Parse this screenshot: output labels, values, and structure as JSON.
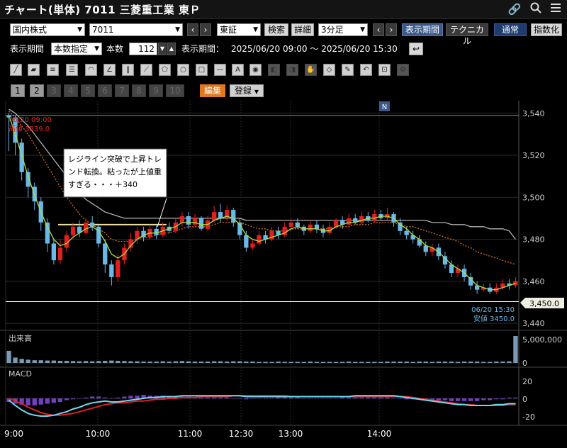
{
  "header": {
    "title": "チャート(単体) 7011 三菱重工業 東Ｐ"
  },
  "toolbar1": {
    "market": "国内株式",
    "code": "7011",
    "exchange": "東証",
    "search_label": "検索",
    "detail_label": "詳細",
    "interval": "3分足",
    "period_label": "表示期間",
    "technical_label": "テクニカル",
    "normal_label": "通常",
    "index_label": "指数化"
  },
  "toolbar2": {
    "display_period_label": "表示期間",
    "period_mode": "本数指定",
    "count_label": "本数",
    "count_value": "112",
    "range_label": "表示期間：",
    "range_value": "2025/06/20 09:00 〜 2025/06/20 15:30"
  },
  "toolbar3": {
    "tools": [
      "line",
      "ruler",
      "hlines",
      "hlines2",
      "arc",
      "fan",
      "vlines",
      "fan2",
      "pentagon",
      "circle",
      "rect",
      "hline",
      "text",
      "icon",
      "dim1",
      "dim2",
      "dim3",
      "eraser",
      "brush",
      "undo",
      "lock",
      "gear"
    ]
  },
  "toolbar4": {
    "pages": [
      "1",
      "2",
      "3",
      "4",
      "5",
      "6",
      "7",
      "8",
      "9",
      "10"
    ],
    "active_pages": 2,
    "edit_label": "編集",
    "register_label": "登録"
  },
  "colors": {
    "background": "#000000",
    "up": "#e02020",
    "down": "#6ab8e8",
    "ma_short": "#a8e040",
    "ma_long": "#b0b0b0",
    "ma_mid": "#d87020",
    "high_line": "#40c040",
    "current_line": "#ffffff",
    "macd": "#70d8f0",
    "signal": "#e02020",
    "hist": "#7040c0"
  },
  "price_chart": {
    "high_time": "06/20 09:00",
    "high_label": "高値 3539.0",
    "low_time": "06/20 15:30",
    "low_label": "安値 3450.0",
    "current_price": "3,450.0",
    "n_badge": "N",
    "annotation": [
      "レジライン突破で上昇トレ",
      "ンド転換。粘ったが上値重",
      "すぎる・・・＋340"
    ]
  },
  "volume_chart": {
    "title": "出来高",
    "max_label": "5,000,000",
    "zero_label": "0"
  },
  "macd_chart": {
    "title": "MACD",
    "labels": [
      "20",
      "0",
      "-20"
    ]
  },
  "chart_data": {
    "type": "candlestick",
    "yticks": [
      3440,
      3460,
      3480,
      3500,
      3520,
      3540
    ],
    "ylim": [
      3437,
      3546
    ],
    "xticks": [
      "9:00",
      "10:00",
      "11:00",
      "12:30",
      "13:00",
      "14:00"
    ],
    "high": 3539.0,
    "low": 3450.0,
    "current": 3450.0,
    "resistance": 3487,
    "candles": [
      [
        3539,
        3538,
        3540,
        3522
      ],
      [
        3538,
        3526,
        3539,
        3520
      ],
      [
        3526,
        3512,
        3528,
        3508
      ],
      [
        3512,
        3505,
        3514,
        3500
      ],
      [
        3505,
        3498,
        3507,
        3494
      ],
      [
        3498,
        3488,
        3500,
        3484
      ],
      [
        3488,
        3478,
        3490,
        3474
      ],
      [
        3478,
        3470,
        3480,
        3468
      ],
      [
        3470,
        3476,
        3480,
        3468
      ],
      [
        3476,
        3482,
        3484,
        3474
      ],
      [
        3482,
        3486,
        3488,
        3480
      ],
      [
        3486,
        3483,
        3489,
        3481
      ],
      [
        3483,
        3488,
        3490,
        3482
      ],
      [
        3488,
        3486,
        3491,
        3484
      ],
      [
        3486,
        3478,
        3487,
        3476
      ],
      [
        3478,
        3468,
        3480,
        3464
      ],
      [
        3468,
        3462,
        3470,
        3458
      ],
      [
        3462,
        3470,
        3473,
        3460
      ],
      [
        3470,
        3476,
        3478,
        3468
      ],
      [
        3476,
        3480,
        3483,
        3474
      ],
      [
        3480,
        3484,
        3486,
        3478
      ],
      [
        3484,
        3481,
        3486,
        3479
      ],
      [
        3481,
        3485,
        3487,
        3480
      ],
      [
        3485,
        3482,
        3487,
        3480
      ],
      [
        3482,
        3486,
        3488,
        3481
      ],
      [
        3486,
        3484,
        3488,
        3483
      ],
      [
        3484,
        3488,
        3490,
        3483
      ],
      [
        3488,
        3491,
        3493,
        3486
      ],
      [
        3491,
        3487,
        3493,
        3485
      ],
      [
        3487,
        3490,
        3492,
        3486
      ],
      [
        3490,
        3485,
        3491,
        3484
      ],
      [
        3485,
        3489,
        3491,
        3484
      ],
      [
        3489,
        3493,
        3496,
        3488
      ],
      [
        3493,
        3490,
        3497,
        3488
      ],
      [
        3490,
        3494,
        3496,
        3489
      ],
      [
        3494,
        3488,
        3495,
        3486
      ],
      [
        3488,
        3482,
        3490,
        3480
      ],
      [
        3482,
        3476,
        3484,
        3474
      ],
      [
        3476,
        3478,
        3480,
        3475
      ],
      [
        3478,
        3482,
        3484,
        3477
      ],
      [
        3482,
        3480,
        3484,
        3478
      ],
      [
        3480,
        3484,
        3486,
        3479
      ],
      [
        3484,
        3482,
        3486,
        3480
      ],
      [
        3482,
        3486,
        3488,
        3481
      ],
      [
        3486,
        3488,
        3490,
        3484
      ],
      [
        3488,
        3486,
        3490,
        3485
      ],
      [
        3486,
        3484,
        3487,
        3482
      ],
      [
        3484,
        3487,
        3489,
        3483
      ],
      [
        3487,
        3485,
        3489,
        3483
      ],
      [
        3485,
        3483,
        3487,
        3481
      ],
      [
        3483,
        3486,
        3488,
        3482
      ],
      [
        3486,
        3489,
        3490,
        3485
      ],
      [
        3489,
        3487,
        3491,
        3485
      ],
      [
        3487,
        3490,
        3492,
        3486
      ],
      [
        3490,
        3488,
        3492,
        3487
      ],
      [
        3488,
        3491,
        3493,
        3487
      ],
      [
        3491,
        3489,
        3493,
        3488
      ],
      [
        3489,
        3492,
        3494,
        3488
      ],
      [
        3492,
        3490,
        3494,
        3489
      ],
      [
        3490,
        3492,
        3495,
        3489
      ],
      [
        3492,
        3488,
        3493,
        3486
      ],
      [
        3488,
        3484,
        3490,
        3482
      ],
      [
        3484,
        3482,
        3486,
        3480
      ],
      [
        3482,
        3480,
        3484,
        3478
      ],
      [
        3480,
        3477,
        3482,
        3476
      ],
      [
        3477,
        3474,
        3479,
        3472
      ],
      [
        3474,
        3476,
        3478,
        3472
      ],
      [
        3476,
        3472,
        3478,
        3470
      ],
      [
        3472,
        3468,
        3474,
        3466
      ],
      [
        3468,
        3464,
        3470,
        3462
      ],
      [
        3464,
        3466,
        3468,
        3462
      ],
      [
        3466,
        3462,
        3468,
        3460
      ],
      [
        3462,
        3458,
        3464,
        3456
      ],
      [
        3458,
        3456,
        3460,
        3454
      ],
      [
        3456,
        3457,
        3459,
        3455
      ],
      [
        3457,
        3455,
        3459,
        3454
      ],
      [
        3455,
        3457,
        3459,
        3454
      ],
      [
        3457,
        3459,
        3461,
        3456
      ],
      [
        3459,
        3458,
        3461,
        3456
      ],
      [
        3458,
        3460,
        3462,
        3457
      ]
    ],
    "ma_short": [
      3539,
      3530,
      3520,
      3510,
      3501,
      3493,
      3486,
      3480,
      3477,
      3478,
      3481,
      3483,
      3485,
      3486,
      3484,
      3479,
      3473,
      3471,
      3473,
      3477,
      3480,
      3482,
      3483,
      3483,
      3484,
      3485,
      3486,
      3488,
      3488,
      3488,
      3487,
      3487,
      3489,
      3490,
      3491,
      3490,
      3487,
      3482,
      3480,
      3479,
      3480,
      3481,
      3482,
      3483,
      3485,
      3486,
      3485,
      3485,
      3485,
      3484,
      3484,
      3486,
      3487,
      3488,
      3488,
      3489,
      3490,
      3490,
      3491,
      3491,
      3490,
      3487,
      3485,
      3482,
      3480,
      3477,
      3476,
      3474,
      3471,
      3468,
      3466,
      3464,
      3461,
      3458,
      3457,
      3456,
      3456,
      3457,
      3458,
      3459
    ],
    "ma_mid": [
      3541,
      3538,
      3534,
      3530,
      3525,
      3520,
      3515,
      3510,
      3505,
      3500,
      3496,
      3492,
      3489,
      3487,
      3485,
      3483,
      3480,
      3479,
      3479,
      3479,
      3480,
      3481,
      3481,
      3482,
      3483,
      3483,
      3484,
      3485,
      3486,
      3486,
      3486,
      3486,
      3487,
      3488,
      3488,
      3488,
      3488,
      3487,
      3486,
      3485,
      3485,
      3484,
      3484,
      3484,
      3485,
      3485,
      3485,
      3485,
      3485,
      3485,
      3485,
      3486,
      3486,
      3486,
      3487,
      3487,
      3487,
      3488,
      3488,
      3488,
      3488,
      3487,
      3486,
      3486,
      3485,
      3484,
      3483,
      3482,
      3481,
      3480,
      3479,
      3477,
      3476,
      3474,
      3473,
      3472,
      3471,
      3470,
      3469,
      3468
    ],
    "ma_long": [
      3542,
      3540,
      3537,
      3534,
      3530,
      3526,
      3522,
      3518,
      3514,
      3510,
      3506,
      3502,
      3499,
      3497,
      3495,
      3493,
      3492,
      3491,
      3490,
      3490,
      3490,
      3490,
      3490,
      3490,
      3490,
      3490,
      3490,
      3490,
      3490,
      3490,
      3490,
      3490,
      3490,
      3490,
      3490,
      3490,
      3490,
      3489,
      3489,
      3489,
      3489,
      3489,
      3489,
      3489,
      3489,
      3489,
      3489,
      3489,
      3489,
      3489,
      3489,
      3489,
      3489,
      3489,
      3489,
      3489,
      3489,
      3489,
      3489,
      3489,
      3489,
      3489,
      3489,
      3489,
      3489,
      3489,
      3488,
      3488,
      3488,
      3487,
      3487,
      3487,
      3486,
      3486,
      3486,
      3485,
      3485,
      3485,
      3484,
      3480
    ],
    "volume": [
      0.45,
      0.2,
      0.15,
      0.12,
      0.1,
      0.1,
      0.09,
      0.09,
      0.08,
      0.08,
      0.07,
      0.06,
      0.07,
      0.06,
      0.07,
      0.08,
      0.09,
      0.08,
      0.07,
      0.06,
      0.06,
      0.05,
      0.05,
      0.05,
      0.06,
      0.05,
      0.06,
      0.07,
      0.06,
      0.05,
      0.05,
      0.05,
      0.06,
      0.06,
      0.05,
      0.06,
      0.06,
      0.05,
      0.05,
      0.04,
      0.04,
      0.04,
      0.05,
      0.04,
      0.04,
      0.04,
      0.04,
      0.05,
      0.04,
      0.04,
      0.04,
      0.04,
      0.04,
      0.05,
      0.04,
      0.04,
      0.04,
      0.04,
      0.04,
      0.05,
      0.05,
      0.05,
      0.05,
      0.04,
      0.05,
      0.05,
      0.04,
      0.05,
      0.05,
      0.05,
      0.04,
      0.05,
      0.05,
      0.05,
      0.04,
      0.04,
      0.05,
      0.05,
      0.06,
      1.0
    ],
    "macd_hist": [
      -4,
      -6,
      -7,
      -8,
      -8,
      -7,
      -6,
      -5,
      -4,
      -2,
      -1,
      0,
      1,
      2,
      2,
      1,
      0,
      1,
      2,
      3,
      3,
      4,
      3,
      3,
      3,
      2,
      2,
      2,
      2,
      1,
      1,
      1,
      1,
      1,
      1,
      0,
      0,
      -1,
      0,
      0,
      0,
      0,
      1,
      1,
      1,
      1,
      0,
      0,
      0,
      0,
      0,
      0,
      1,
      1,
      1,
      1,
      1,
      1,
      1,
      1,
      0,
      0,
      -1,
      -1,
      -1,
      -2,
      -2,
      -2,
      -2,
      -3,
      -3,
      -3,
      -3,
      -3,
      -2,
      -2,
      -1,
      -1,
      1,
      1
    ],
    "macd": [
      -2,
      -8,
      -13,
      -17,
      -19,
      -20,
      -20,
      -19,
      -17,
      -15,
      -12,
      -10,
      -7,
      -5,
      -4,
      -3,
      -4,
      -4,
      -3,
      -2,
      -1,
      0,
      1,
      1,
      2,
      2,
      2,
      3,
      3,
      3,
      3,
      3,
      3,
      3,
      3,
      3,
      3,
      2,
      2,
      2,
      2,
      2,
      2,
      2,
      2,
      2,
      2,
      2,
      2,
      2,
      2,
      2,
      2,
      2,
      3,
      3,
      3,
      3,
      3,
      3,
      3,
      2,
      1,
      0,
      -1,
      -2,
      -3,
      -4,
      -5,
      -6,
      -7,
      -7,
      -8,
      -8,
      -8,
      -8,
      -7,
      -7,
      -6,
      -6
    ],
    "signal": [
      0,
      -3,
      -6,
      -10,
      -13,
      -16,
      -18,
      -19,
      -19,
      -18,
      -17,
      -15,
      -13,
      -11,
      -9,
      -7,
      -6,
      -5,
      -5,
      -4,
      -3,
      -3,
      -2,
      -1,
      -1,
      0,
      0,
      1,
      1,
      1,
      2,
      2,
      2,
      2,
      2,
      3,
      3,
      3,
      3,
      3,
      3,
      3,
      3,
      3,
      2,
      2,
      2,
      2,
      2,
      2,
      2,
      2,
      2,
      2,
      2,
      2,
      2,
      2,
      2,
      2,
      2,
      2,
      2,
      1,
      0,
      -1,
      -2,
      -3,
      -4,
      -5,
      -6,
      -7,
      -7,
      -8,
      -8,
      -8,
      -8,
      -8,
      -7,
      -7
    ]
  }
}
